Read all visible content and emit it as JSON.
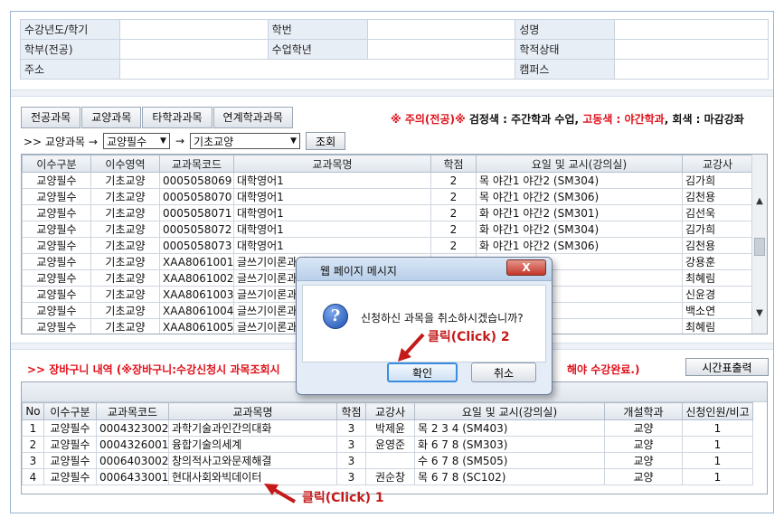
{
  "info": {
    "rows": [
      [
        {
          "label": "수강년도/학기",
          "value": ""
        },
        {
          "label": "학번",
          "value": ""
        },
        {
          "label": "성명",
          "value": ""
        }
      ],
      [
        {
          "label": "학부(전공)",
          "value": ""
        },
        {
          "label": "수업학년",
          "value": ""
        },
        {
          "label": "학적상태",
          "value": ""
        }
      ]
    ],
    "address_label": "주소",
    "address_value": "",
    "campus_label": "캠퍼스",
    "campus_value": ""
  },
  "tabs": [
    "전공과목",
    "교양과목",
    "타학과과목",
    "연계학과과목"
  ],
  "notice": {
    "warning": "※ 주의(전공)※",
    "part1": " 검정색 : 주간학과 수업, ",
    "highlight": "고동색 : 야간학과",
    "part2": ", 회색 : 마감강좌"
  },
  "filter": {
    "prefix": ">> 교양과목 →",
    "select1": "교양필수",
    "arrow": "→",
    "select2": "기초교양",
    "search_button": "조회"
  },
  "course_table": {
    "headers": [
      "이수구분",
      "이수영역",
      "교과목코드",
      "교과목명",
      "학점",
      "요일 및 교시(강의실)",
      "교강사"
    ],
    "rows": [
      [
        "교양필수",
        "기초교양",
        "0005058069",
        "대학영어1",
        "2",
        "목 야간1 야간2 (SM304)",
        "김가희"
      ],
      [
        "교양필수",
        "기초교양",
        "0005058070",
        "대학영어1",
        "2",
        "목 야간1 야간2 (SM306)",
        "김천용"
      ],
      [
        "교양필수",
        "기초교양",
        "0005058071",
        "대학영어1",
        "2",
        "화 야간1 야간2 (SM301)",
        "김선욱"
      ],
      [
        "교양필수",
        "기초교양",
        "0005058072",
        "대학영어1",
        "2",
        "화 야간1 야간2 (SM304)",
        "김가희"
      ],
      [
        "교양필수",
        "기초교양",
        "0005058073",
        "대학영어1",
        "2",
        "화 야간1 야간2 (SM306)",
        "김천용"
      ],
      [
        "교양필수",
        "기초교양",
        "XAA8061001",
        "글쓰기이론과실제",
        "",
        "",
        "강용훈"
      ],
      [
        "교양필수",
        "기초교양",
        "XAA8061002",
        "글쓰기이론과실제",
        "",
        "",
        "최혜림"
      ],
      [
        "교양필수",
        "기초교양",
        "XAA8061003",
        "글쓰기이론과실제",
        "",
        "",
        "신윤경"
      ],
      [
        "교양필수",
        "기초교양",
        "XAA8061004",
        "글쓰기이론과실제",
        "",
        "",
        "백소연"
      ],
      [
        "교양필수",
        "기초교양",
        "XAA8061005",
        "글쓰기이론과실제",
        "",
        "",
        "최혜림"
      ]
    ]
  },
  "cart": {
    "title_left": ">> 장바구니 내역 (※장바구니:수강신청시 과목조회시",
    "title_right": "해야 수강완료.)",
    "print_button": "시간표출력",
    "headers": [
      "No",
      "이수구분",
      "교과목코드",
      "교과목명",
      "학점",
      "교강사",
      "요일 및 교시(강의실)",
      "개설학과",
      "신청인원/비고"
    ],
    "rows": [
      [
        "1",
        "교양필수",
        "0004323002",
        "과학기술과인간의대화",
        "3",
        "박제윤",
        "목 2 3 4 (SM403)",
        "교양",
        "1"
      ],
      [
        "2",
        "교양필수",
        "0004326001",
        "융합기술의세계",
        "3",
        "윤영준",
        "화 6 7 8 (SM303)",
        "교양",
        "1"
      ],
      [
        "3",
        "교양필수",
        "0006403002",
        "창의적사고와문제해결",
        "3",
        "",
        "수 6 7 8 (SM505)",
        "교양",
        "1"
      ],
      [
        "4",
        "교양필수",
        "0006433001",
        "현대사회와빅데이터",
        "3",
        "권순창",
        "목 6 7 8 (SC102)",
        "교양",
        "1"
      ]
    ]
  },
  "dialog": {
    "title": "웹 페이지 메시지",
    "close": "X",
    "icon": "question-icon",
    "message": "신청하신 과목을 취소하시겠습니까?",
    "ok": "확인",
    "cancel": "취소"
  },
  "annotations": {
    "click1": "클릭(Click) 1",
    "click2": "클릭(Click) 2",
    "color": "#c41a1a"
  }
}
